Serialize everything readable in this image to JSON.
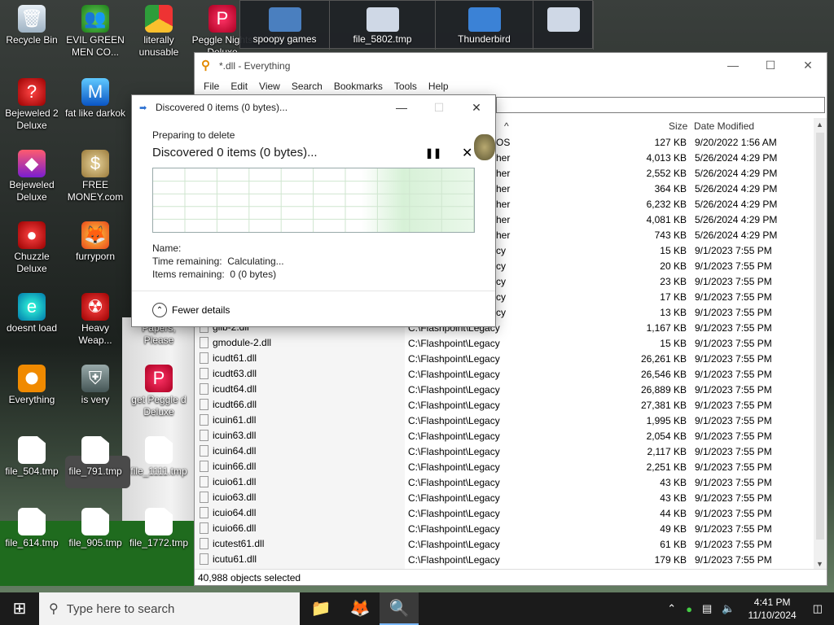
{
  "desktop": {
    "icons": [
      {
        "label": "Recycle Bin",
        "icon": "recycle-bin-icon",
        "cls": "g-bin",
        "glyph": "🗑"
      },
      {
        "label": "EVIL GREEN MEN CO...",
        "icon": "green-men-icon",
        "cls": "g-green",
        "glyph": "👥"
      },
      {
        "label": "literally unusable",
        "icon": "chrome-icon",
        "cls": "g-chrome",
        "glyph": ""
      },
      {
        "label": "Peggle Nights Deluxe",
        "icon": "peggle-icon",
        "cls": "g-peggle",
        "glyph": "P"
      },
      {
        "label": "Bejeweled 2 Deluxe",
        "icon": "bejeweled2-icon",
        "cls": "g-red",
        "glyph": "?"
      },
      {
        "label": "fat like darkok",
        "icon": "mj-icon",
        "cls": "g-blue",
        "glyph": "M"
      },
      {
        "label": "Bejeweled Deluxe",
        "icon": "bejeweled-icon",
        "cls": "g-gem",
        "glyph": "◆"
      },
      {
        "label": "FREE MONEY.com",
        "icon": "money-bag-icon",
        "cls": "g-money",
        "glyph": "$"
      },
      {
        "label": "Chuzzle Deluxe",
        "icon": "chuzzle-icon",
        "cls": "g-red",
        "glyph": "●"
      },
      {
        "label": "furryporn",
        "icon": "firefox-icon",
        "cls": "g-ff",
        "glyph": "🦊"
      },
      {
        "label": "doesnt load",
        "icon": "edge-icon",
        "cls": "g-edge",
        "glyph": "e"
      },
      {
        "label": "Heavy Weap...",
        "icon": "radiation-icon",
        "cls": "g-red",
        "glyph": "☢"
      },
      {
        "label": "Papers, Please",
        "icon": "papers-please-icon",
        "cls": "g-shield",
        "glyph": ""
      },
      {
        "label": "Everything",
        "icon": "everything-icon",
        "cls": "g-orange",
        "glyph": ""
      },
      {
        "label": "is very",
        "icon": "shield-icon",
        "cls": "g-shield",
        "glyph": "⛨"
      },
      {
        "label": "get Peggle d Deluxe",
        "icon": "peggle-icon",
        "cls": "g-peggle",
        "glyph": "P"
      },
      {
        "label": "file_504.tmp",
        "icon": "file-icon",
        "cls": "g-file",
        "glyph": ""
      },
      {
        "label": "file_791.tmp",
        "icon": "file-icon",
        "cls": "g-file",
        "glyph": ""
      },
      {
        "label": "file_1111.tmp",
        "icon": "file-icon",
        "cls": "g-file",
        "glyph": ""
      },
      {
        "label": "file_614.tmp",
        "icon": "file-icon",
        "cls": "g-file",
        "glyph": ""
      },
      {
        "label": "file_905.tmp",
        "icon": "file-icon",
        "cls": "g-file",
        "glyph": ""
      },
      {
        "label": "file_1772.tmp",
        "icon": "file-icon",
        "cls": "g-file",
        "glyph": ""
      }
    ],
    "thumbnails": [
      {
        "label": "spoopy games",
        "icon": "computers-icon"
      },
      {
        "label": "file_5802.tmp",
        "icon": "file-icon"
      },
      {
        "label": "Thunderbird",
        "icon": "windows-folder-icon"
      },
      {
        "label": "",
        "icon": "recycle-bin-icon"
      }
    ]
  },
  "everything": {
    "title": "*.dll - Everything",
    "menu": [
      "File",
      "Edit",
      "View",
      "Search",
      "Bookmarks",
      "Tools",
      "Help"
    ],
    "columns": {
      "size": "Size",
      "date": "Date Modified"
    },
    "rows": [
      {
        "name": "",
        "path": "OS",
        "size": "127 KB",
        "date": "9/20/2022 1:56 AM"
      },
      {
        "name": "",
        "path": "her",
        "size": "4,013 KB",
        "date": "5/26/2024 4:29 PM"
      },
      {
        "name": "",
        "path": "her",
        "size": "2,552 KB",
        "date": "5/26/2024 4:29 PM"
      },
      {
        "name": "",
        "path": "her",
        "size": "364 KB",
        "date": "5/26/2024 4:29 PM"
      },
      {
        "name": "",
        "path": "her",
        "size": "6,232 KB",
        "date": "5/26/2024 4:29 PM"
      },
      {
        "name": "",
        "path": "her",
        "size": "4,081 KB",
        "date": "5/26/2024 4:29 PM"
      },
      {
        "name": "",
        "path": "her",
        "size": "743 KB",
        "date": "5/26/2024 4:29 PM"
      },
      {
        "name": "",
        "path": "cy",
        "size": "15 KB",
        "date": "9/1/2023 7:55 PM"
      },
      {
        "name": "",
        "path": "cy",
        "size": "20 KB",
        "date": "9/1/2023 7:55 PM"
      },
      {
        "name": "",
        "path": "cy",
        "size": "23 KB",
        "date": "9/1/2023 7:55 PM"
      },
      {
        "name": "",
        "path": "cy",
        "size": "17 KB",
        "date": "9/1/2023 7:55 PM"
      },
      {
        "name": "",
        "path": "cy",
        "size": "13 KB",
        "date": "9/1/2023 7:55 PM"
      },
      {
        "name": "glib-2.dll",
        "path": "C:\\Flashpoint\\Legacy",
        "size": "1,167 KB",
        "date": "9/1/2023 7:55 PM"
      },
      {
        "name": "gmodule-2.dll",
        "path": "C:\\Flashpoint\\Legacy",
        "size": "15 KB",
        "date": "9/1/2023 7:55 PM"
      },
      {
        "name": "icudt61.dll",
        "path": "C:\\Flashpoint\\Legacy",
        "size": "26,261 KB",
        "date": "9/1/2023 7:55 PM"
      },
      {
        "name": "icudt63.dll",
        "path": "C:\\Flashpoint\\Legacy",
        "size": "26,546 KB",
        "date": "9/1/2023 7:55 PM"
      },
      {
        "name": "icudt64.dll",
        "path": "C:\\Flashpoint\\Legacy",
        "size": "26,889 KB",
        "date": "9/1/2023 7:55 PM"
      },
      {
        "name": "icudt66.dll",
        "path": "C:\\Flashpoint\\Legacy",
        "size": "27,381 KB",
        "date": "9/1/2023 7:55 PM"
      },
      {
        "name": "icuin61.dll",
        "path": "C:\\Flashpoint\\Legacy",
        "size": "1,995 KB",
        "date": "9/1/2023 7:55 PM"
      },
      {
        "name": "icuin63.dll",
        "path": "C:\\Flashpoint\\Legacy",
        "size": "2,054 KB",
        "date": "9/1/2023 7:55 PM"
      },
      {
        "name": "icuin64.dll",
        "path": "C:\\Flashpoint\\Legacy",
        "size": "2,117 KB",
        "date": "9/1/2023 7:55 PM"
      },
      {
        "name": "icuin66.dll",
        "path": "C:\\Flashpoint\\Legacy",
        "size": "2,251 KB",
        "date": "9/1/2023 7:55 PM"
      },
      {
        "name": "icuio61.dll",
        "path": "C:\\Flashpoint\\Legacy",
        "size": "43 KB",
        "date": "9/1/2023 7:55 PM"
      },
      {
        "name": "icuio63.dll",
        "path": "C:\\Flashpoint\\Legacy",
        "size": "43 KB",
        "date": "9/1/2023 7:55 PM"
      },
      {
        "name": "icuio64.dll",
        "path": "C:\\Flashpoint\\Legacy",
        "size": "44 KB",
        "date": "9/1/2023 7:55 PM"
      },
      {
        "name": "icuio66.dll",
        "path": "C:\\Flashpoint\\Legacy",
        "size": "49 KB",
        "date": "9/1/2023 7:55 PM"
      },
      {
        "name": "icutest61.dll",
        "path": "C:\\Flashpoint\\Legacy",
        "size": "61 KB",
        "date": "9/1/2023 7:55 PM"
      },
      {
        "name": "icutu61.dll",
        "path": "C:\\Flashpoint\\Legacy",
        "size": "179 KB",
        "date": "9/1/2023 7:55 PM"
      }
    ],
    "status": "40,988 objects selected"
  },
  "dialog": {
    "title": "Discovered 0 items (0 bytes)...",
    "preparing": "Preparing to delete",
    "discovered": "Discovered 0 items (0 bytes)...",
    "name_label": "Name:",
    "time_label": "Time remaining:",
    "time_value": "Calculating...",
    "items_label": "Items remaining:",
    "items_value": "0 (0 bytes)",
    "fewer_details": "Fewer details",
    "pause_icon": "pause-icon",
    "cancel_icon": "close-icon"
  },
  "taskbar": {
    "search_placeholder": "Type here to search",
    "apps": [
      {
        "icon": "file-explorer-icon",
        "glyph": "📁"
      },
      {
        "icon": "firefox-icon",
        "glyph": "🦊"
      },
      {
        "icon": "everything-search-icon",
        "glyph": "🔍"
      }
    ],
    "time": "4:41 PM",
    "date": "11/10/2024"
  },
  "colors": {
    "accent": "#0078d7",
    "taskbar": "#1b1b1b",
    "everything_icon": "#e38a00"
  }
}
